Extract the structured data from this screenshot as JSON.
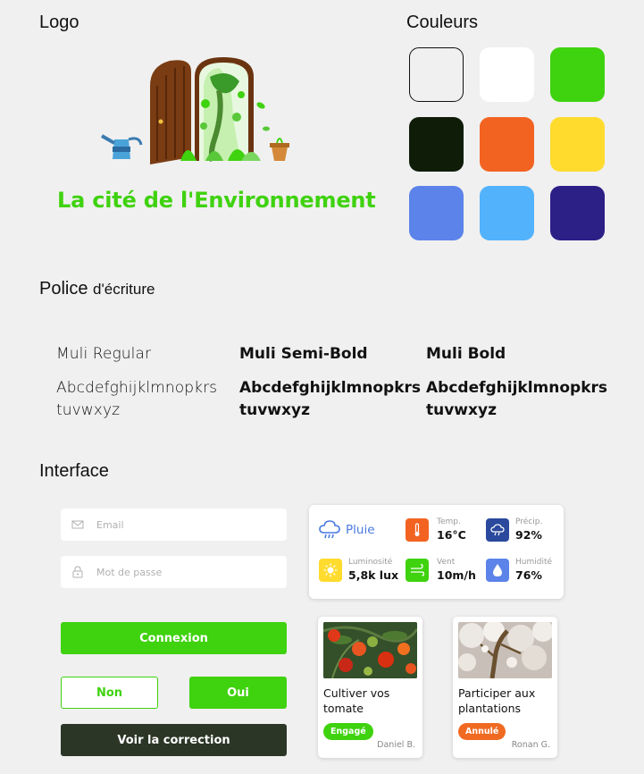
{
  "sections": {
    "logo_title": "Logo",
    "colors_title": "Couleurs",
    "font_title_main": "Police",
    "font_title_sub": "d'écriture",
    "interface_title": "Interface"
  },
  "logo": {
    "text": "La cité de l'Environnement",
    "text_color": "#3fd20f"
  },
  "colors": [
    "#f0f0f0",
    "#ffffff",
    "#3fd20f",
    "#0f1c08",
    "#f26322",
    "#ffdb2e",
    "#5b83e9",
    "#52b2fb",
    "#2c1f86"
  ],
  "fonts": [
    {
      "name": "Muli Regular",
      "sample_line1": "Abcdefghijklmnopkrs",
      "sample_line2": "tuvwxyz"
    },
    {
      "name": "Muli Semi-Bold",
      "sample_line1": "Abcdefghijklmnopkrs",
      "sample_line2": "tuvwxyz"
    },
    {
      "name": "Muli Bold",
      "sample_line1": "Abcdefghijklmnopkrs",
      "sample_line2": "tuvwxyz"
    }
  ],
  "form": {
    "email_placeholder": "Email",
    "password_placeholder": "Mot de passe",
    "login_label": "Connexion",
    "no_label": "Non",
    "yes_label": "Oui",
    "correction_label": "Voir la correction"
  },
  "weather": {
    "condition": "Pluie",
    "items": [
      {
        "label": "Temp.",
        "value": "16°C",
        "icon": "thermometer-icon",
        "color": "#f26322"
      },
      {
        "label": "Précip.",
        "value": "92%",
        "icon": "cloud-rain-icon",
        "color": "#2b4a9e"
      },
      {
        "label": "Luminosité",
        "value": "5,8k lux",
        "icon": "sun-icon",
        "color": "#ffdb2e"
      },
      {
        "label": "Vent",
        "value": "10m/h",
        "icon": "wind-icon",
        "color": "#3fd20f"
      },
      {
        "label": "Humidité",
        "value": "76%",
        "icon": "droplet-icon",
        "color": "#5b83e9"
      }
    ]
  },
  "cards": [
    {
      "title": "Cultiver vos tomate",
      "badge": "Engagé",
      "badge_color": "#3fd20f",
      "author": "Daniel B."
    },
    {
      "title": "Participer aux plantations",
      "badge": "Annulé",
      "badge_color": "#f06a22",
      "author": "Ronan G."
    }
  ]
}
